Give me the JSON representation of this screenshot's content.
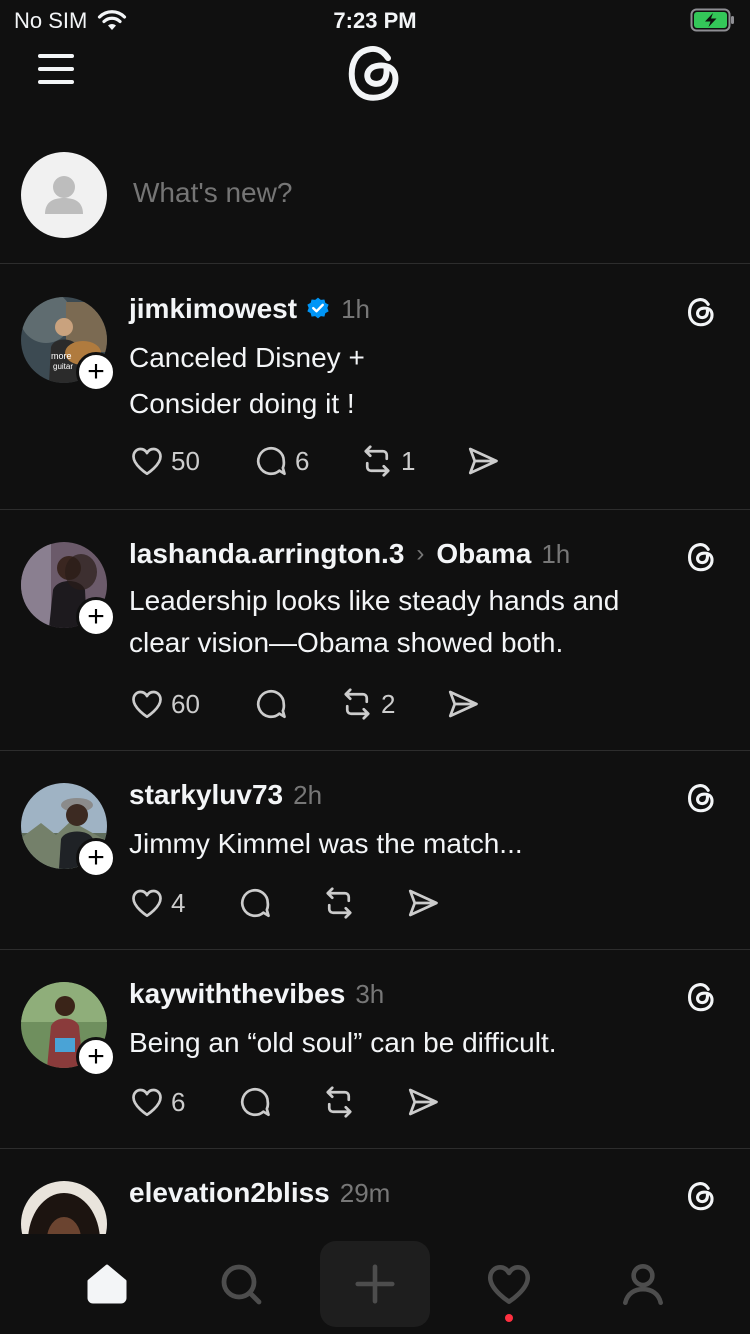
{
  "status_bar": {
    "carrier": "No SIM",
    "time": "7:23 PM"
  },
  "composer": {
    "placeholder": "What's new?"
  },
  "posts": [
    {
      "username": "jimkimowest",
      "verified": true,
      "time": "1h",
      "lines": [
        "Canceled Disney +",
        "Consider doing it !"
      ],
      "likes": "50",
      "replies": "6",
      "reposts": "1",
      "avatar_text": [
        "more",
        "guitar"
      ]
    },
    {
      "username": "lashanda.arrington.3",
      "topic": "Obama",
      "time": "1h",
      "lines": [
        "Leadership looks like steady hands and",
        "clear vision—Obama showed both."
      ],
      "likes": "60",
      "replies": "",
      "reposts": "2"
    },
    {
      "username": "starkyluv73",
      "time": "2h",
      "lines": [
        "Jimmy Kimmel was the match..."
      ],
      "likes": "4",
      "replies": "",
      "reposts": ""
    },
    {
      "username": "kaywiththevibes",
      "time": "3h",
      "lines": [
        "Being an “old soul” can be difficult."
      ],
      "likes": "6",
      "replies": "",
      "reposts": ""
    },
    {
      "username": "elevation2bliss",
      "time": "29m",
      "lines": [],
      "likes": "",
      "replies": "",
      "reposts": ""
    }
  ],
  "icons": {
    "like": "heart-icon",
    "reply": "comment-icon",
    "repost": "repost-icon",
    "share": "send-icon",
    "threads": "threads-logo-icon",
    "verified": "verified-badge-icon"
  },
  "colors": {
    "background": "#101010",
    "verified": "#0095f6",
    "notification": "#ff3040"
  }
}
